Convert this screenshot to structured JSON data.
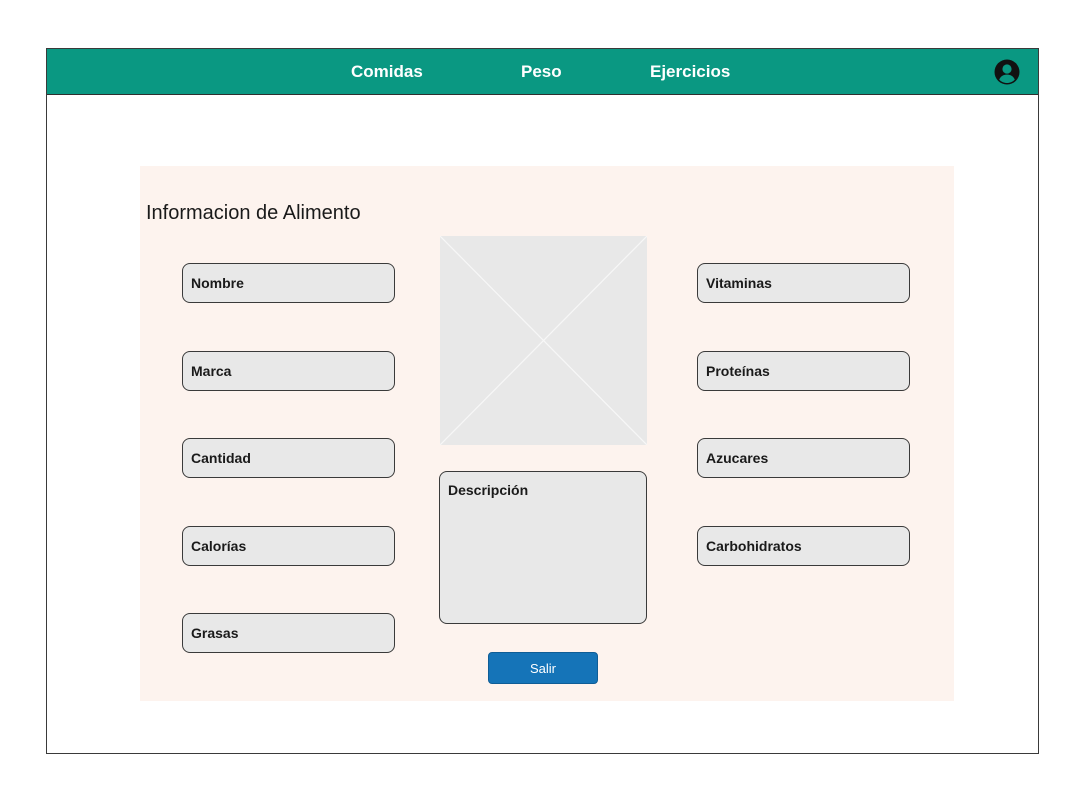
{
  "nav": {
    "items": [
      {
        "label": "Comidas"
      },
      {
        "label": "Peso"
      },
      {
        "label": "Ejercicios"
      }
    ],
    "user_icon": "user-circle-icon",
    "background_color": "#0a9882"
  },
  "panel": {
    "title": "Informacion de Alimento",
    "left_fields": [
      {
        "label": "Nombre"
      },
      {
        "label": "Marca"
      },
      {
        "label": "Cantidad"
      },
      {
        "label": "Calorías"
      },
      {
        "label": "Grasas"
      }
    ],
    "right_fields": [
      {
        "label": "Vitaminas"
      },
      {
        "label": "Proteínas"
      },
      {
        "label": "Azucares"
      },
      {
        "label": "Carbohidratos"
      }
    ],
    "image_placeholder_icon": "image-placeholder-icon",
    "description_label": "Descripción",
    "exit_button": "Salir",
    "background_color": "#fdf3ee"
  }
}
